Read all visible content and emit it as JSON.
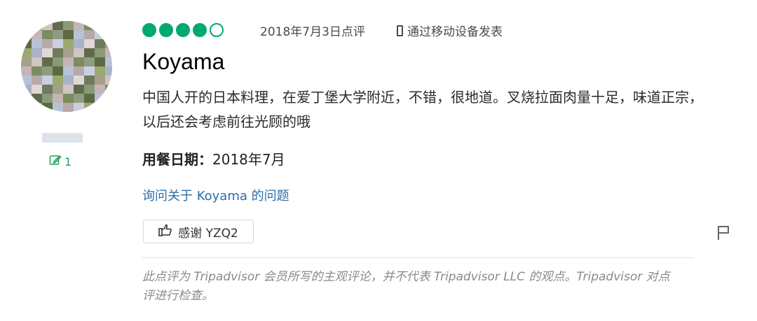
{
  "review": {
    "rating": 4,
    "max_rating": 5,
    "date": "2018年7月3日点评",
    "source": "通过移动设备发表",
    "title": "Koyama",
    "body": "中国人开的日本料理，在爱丁堡大学附近，不错，很地道。叉烧拉面肉量十足，味道正宗，以后还会考虑前往光顾的哦",
    "visit_label": "用餐日期：",
    "visit_value": "2018年7月",
    "ask_link": "询问关于 Koyama 的问题",
    "thanks_label": "感谢 YZQ2",
    "disclaimer": "此点评为 Tripadvisor 会员所写的主观评论，并不代表 Tripadvisor LLC 的观点。Tripadvisor 对点评进行检查。"
  },
  "reviewer": {
    "contributions": "1",
    "contrib_icon": "edit-icon"
  },
  "icons": {
    "source": "phone-icon",
    "thanks": "thumbs-up-icon",
    "report": "flag-icon"
  },
  "colors": {
    "bubble": "#00aa6c",
    "link": "#2b6ea8",
    "contrib": "#2e9e5b"
  }
}
